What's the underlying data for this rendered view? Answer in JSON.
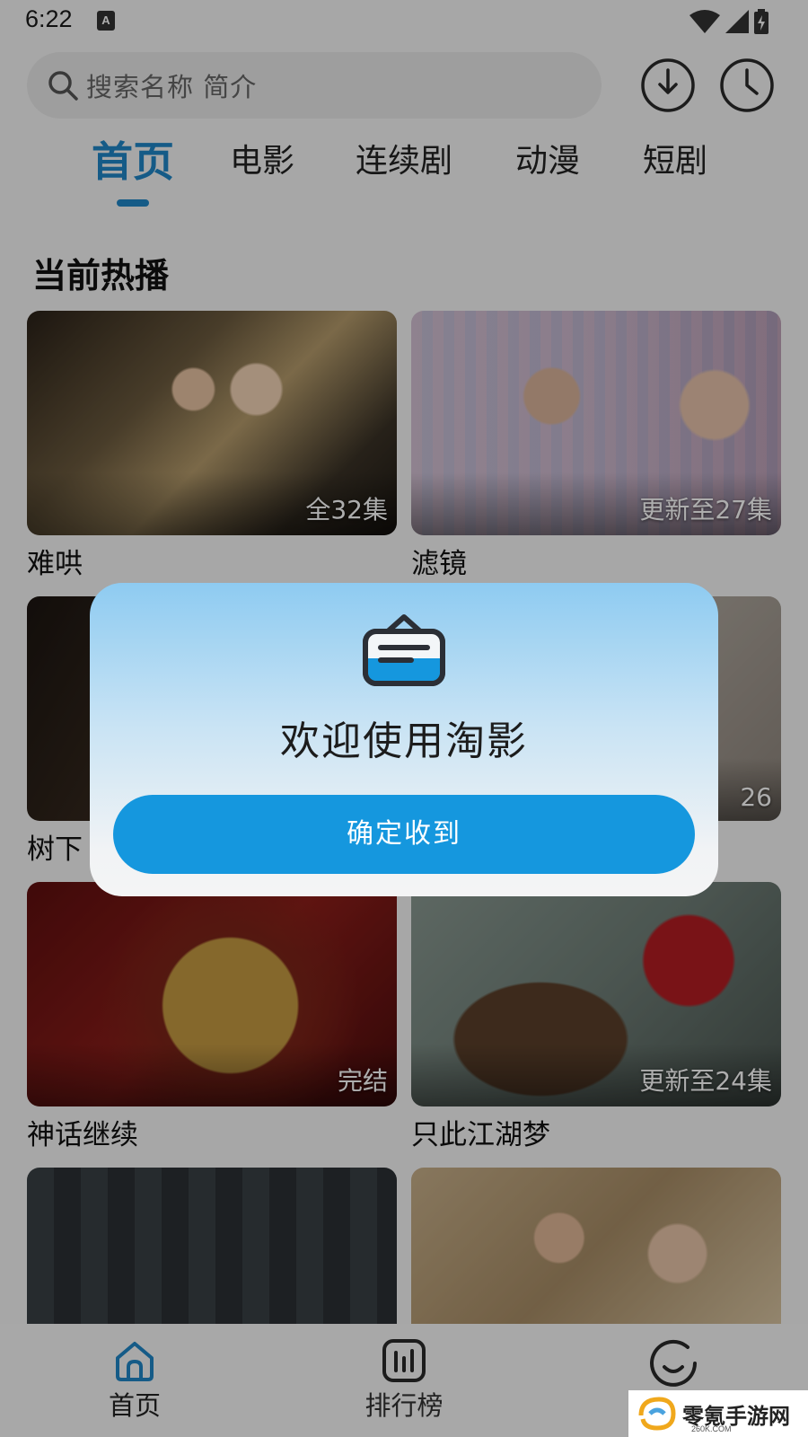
{
  "status_bar": {
    "time": "6:22",
    "notification_glyph": "A"
  },
  "search": {
    "placeholder": "搜索名称 简介"
  },
  "header_icons": [
    "download-icon",
    "history-icon"
  ],
  "tabs": [
    {
      "label": "首页",
      "active": true
    },
    {
      "label": "电影",
      "active": false
    },
    {
      "label": "连续剧",
      "active": false
    },
    {
      "label": "动漫",
      "active": false
    },
    {
      "label": "短剧",
      "active": false
    }
  ],
  "section": {
    "title": "当前热播"
  },
  "cards": [
    {
      "title": "难哄",
      "badge": "全32集"
    },
    {
      "title": "滤镜",
      "badge": "更新至27集"
    },
    {
      "title": "树下",
      "badge": ""
    },
    {
      "title": "",
      "badge": "26"
    },
    {
      "title": "神话继续",
      "badge": "完结"
    },
    {
      "title": "只此江湖梦",
      "badge": "更新至24集"
    },
    {
      "title": "",
      "badge": ""
    },
    {
      "title": "",
      "badge": ""
    }
  ],
  "dialog": {
    "title": "欢迎使用淘影",
    "confirm_label": "确定收到"
  },
  "bottom_nav": [
    {
      "label": "首页",
      "icon": "home-icon",
      "active": true
    },
    {
      "label": "排行榜",
      "icon": "chart-icon",
      "active": false
    },
    {
      "label": "",
      "icon": "profile-icon",
      "active": false
    }
  ],
  "watermark": {
    "text": "零氪手游网",
    "sub": "260K.COM"
  },
  "colors": {
    "accent": "#1f86c7",
    "dialog_button": "#1597de"
  }
}
